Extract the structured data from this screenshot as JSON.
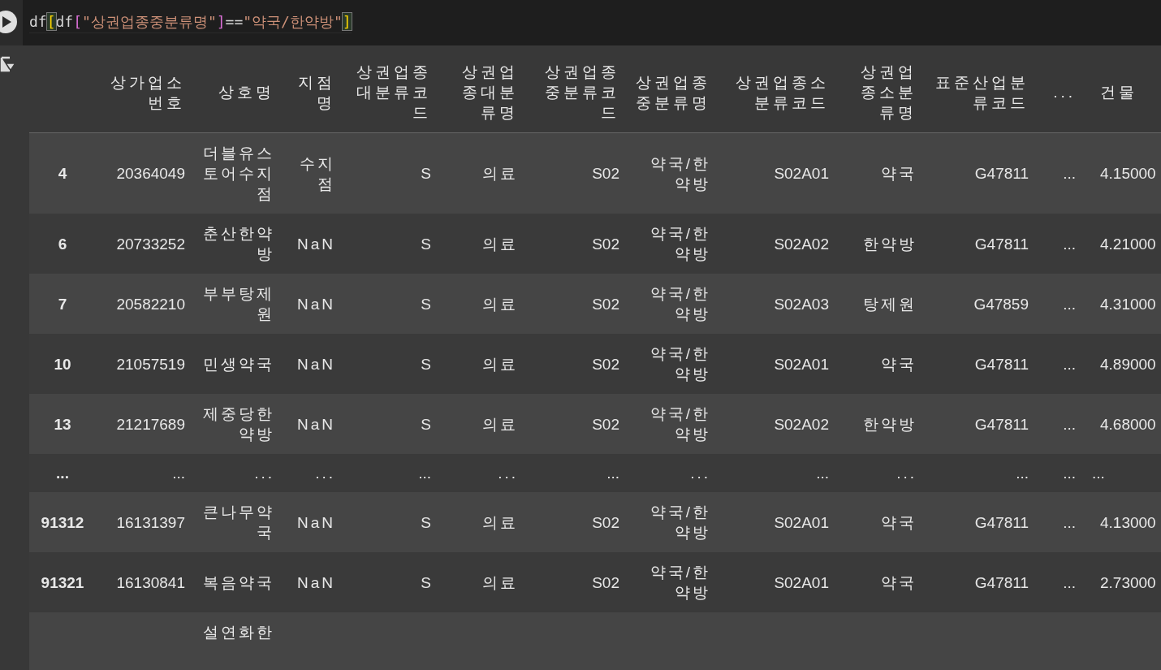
{
  "code_cell": {
    "tokens": [
      {
        "kind": "plain",
        "text": "df"
      },
      {
        "kind": "matched-bracket",
        "text": "["
      },
      {
        "kind": "plain",
        "text": "df"
      },
      {
        "kind": "bracket",
        "text": "["
      },
      {
        "kind": "string",
        "text": "\"상권업종중분류명\""
      },
      {
        "kind": "bracket",
        "text": "]"
      },
      {
        "kind": "plain",
        "text": "=="
      },
      {
        "kind": "string",
        "text": "\"약국/한약방\""
      },
      {
        "kind": "matched-bracket",
        "text": "]"
      }
    ]
  },
  "table": {
    "columns": [
      "상가업소번호",
      "상호명",
      "지점명",
      "상권업종대분류코드",
      "상권업종대분류명",
      "상권업종중분류코드",
      "상권업종중분류명",
      "상권업종소분류코드",
      "상권업종소분류명",
      "표준산업분류코드",
      "...",
      "건물"
    ],
    "rows": [
      {
        "index": "4",
        "cells": [
          "20364049",
          "더블유스토어수지점",
          "수지점",
          "S",
          "의료",
          "S02",
          "약국/한약방",
          "S02A01",
          "약국",
          "G47811",
          "...",
          "4.15000"
        ]
      },
      {
        "index": "6",
        "cells": [
          "20733252",
          "춘산한약방",
          "NaN",
          "S",
          "의료",
          "S02",
          "약국/한약방",
          "S02A02",
          "한약방",
          "G47811",
          "...",
          "4.21000"
        ]
      },
      {
        "index": "7",
        "cells": [
          "20582210",
          "부부탕제원",
          "NaN",
          "S",
          "의료",
          "S02",
          "약국/한약방",
          "S02A03",
          "탕제원",
          "G47859",
          "...",
          "4.31000"
        ]
      },
      {
        "index": "10",
        "cells": [
          "21057519",
          "민생약국",
          "NaN",
          "S",
          "의료",
          "S02",
          "약국/한약방",
          "S02A01",
          "약국",
          "G47811",
          "...",
          "4.89000"
        ]
      },
      {
        "index": "13",
        "cells": [
          "21217689",
          "제중당한약방",
          "NaN",
          "S",
          "의료",
          "S02",
          "약국/한약방",
          "S02A02",
          "한약방",
          "G47811",
          "...",
          "4.68000"
        ]
      },
      {
        "index": "...",
        "cells": [
          "...",
          "...",
          "...",
          "...",
          "...",
          "...",
          "...",
          "...",
          "...",
          "...",
          "...",
          "..."
        ]
      },
      {
        "index": "91312",
        "cells": [
          "16131397",
          "큰나무약국",
          "NaN",
          "S",
          "의료",
          "S02",
          "약국/한약방",
          "S02A01",
          "약국",
          "G47811",
          "...",
          "4.13000"
        ]
      },
      {
        "index": "91321",
        "cells": [
          "16130841",
          "복음약국",
          "NaN",
          "S",
          "의료",
          "S02",
          "약국/한약방",
          "S02A01",
          "약국",
          "G47811",
          "...",
          "2.73000"
        ]
      }
    ],
    "cut_row": {
      "name_first_line": "설연화한"
    }
  }
}
